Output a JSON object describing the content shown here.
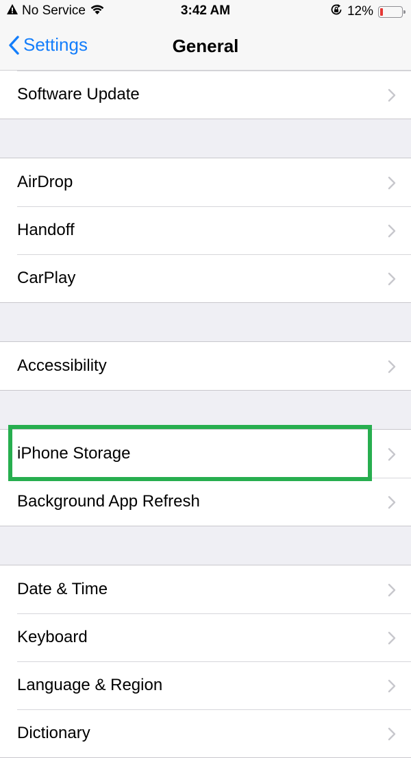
{
  "status_bar": {
    "carrier": "No Service",
    "time": "3:42 AM",
    "battery_percent": "12%",
    "battery_level": 0.12,
    "icons": [
      "warning-icon",
      "wifi-icon",
      "rotation-lock-icon",
      "battery-icon"
    ]
  },
  "nav": {
    "back_label": "Settings",
    "title": "General"
  },
  "groups": [
    {
      "items": [
        {
          "label": "Software Update"
        }
      ]
    },
    {
      "items": [
        {
          "label": "AirDrop"
        },
        {
          "label": "Handoff"
        },
        {
          "label": "CarPlay"
        }
      ]
    },
    {
      "items": [
        {
          "label": "Accessibility"
        }
      ]
    },
    {
      "items": [
        {
          "label": "iPhone Storage",
          "highlighted": true
        },
        {
          "label": "Background App Refresh"
        }
      ]
    },
    {
      "items": [
        {
          "label": "Date & Time"
        },
        {
          "label": "Keyboard"
        },
        {
          "label": "Language & Region"
        },
        {
          "label": "Dictionary"
        }
      ]
    }
  ],
  "colors": {
    "accent": "#147efb",
    "highlight_box": "#27ae4f",
    "battery_low": "#e53935",
    "background": "#efeff4"
  }
}
